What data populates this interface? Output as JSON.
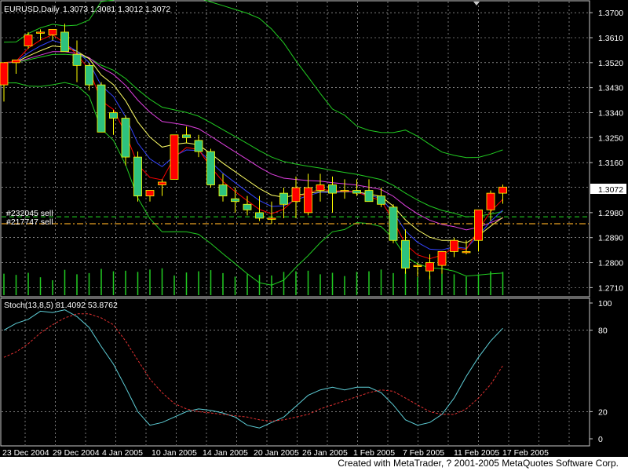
{
  "header": {
    "symbol": "EURUSD,Daily",
    "ohlc": "1.3073 1.3081 1.3012 1.3072"
  },
  "orders": [
    "#232045 sell",
    "#217747 sell"
  ],
  "stoch": {
    "label": "Stoch(13,8,5) 81.4092 53.8762"
  },
  "credit": "Created with MetaTrader, ? 2001-2005 MetaQuotes Software Corp.",
  "current_price": "1.3072",
  "price_axis": [
    "1.3700",
    "1.3610",
    "1.3520",
    "1.3430",
    "1.3340",
    "1.3250",
    "1.3160",
    "1.3072",
    "1.2980",
    "1.2890",
    "1.2800",
    "1.2710"
  ],
  "stoch_axis": [
    "100",
    "80",
    "20",
    "0"
  ],
  "date_axis": [
    "23 Dec 2004",
    "29 Dec 2004",
    "4 Jan 2005",
    "10 Jan 2005",
    "14 Jan 2005",
    "20 Jan 2005",
    "26 Jan 2005",
    "1 Feb 2005",
    "7 Feb 2005",
    "11 Feb 2005",
    "17 Feb 2005"
  ],
  "colors": {
    "background": "#000000",
    "grid": "#c8c8c8",
    "bull": "#ff0000",
    "bear": "#2ec27e",
    "wick": "#ffff00",
    "ma_red": "#ff0000",
    "ma_blue": "#3344ff",
    "ma_yellow": "#ffff66",
    "ma_magenta": "#e040e0",
    "bands": "#22cc22",
    "volume": "#22cc22",
    "stoch_main": "#5ecfd8",
    "stoch_signal": "#e03030",
    "order1_line": "#22cc22",
    "order2_line": "#e8a020"
  },
  "chart_data": [
    {
      "type": "candlestick",
      "title": "EURUSD,Daily",
      "ylim": [
        1.268,
        1.374
      ],
      "x": [
        "22 Dec 2004",
        "23 Dec 2004",
        "24 Dec 2004",
        "27 Dec 2004",
        "28 Dec 2004",
        "29 Dec 2004",
        "30 Dec 2004",
        "31 Dec 2004",
        "3 Jan 2005",
        "4 Jan 2005",
        "5 Jan 2005",
        "6 Jan 2005",
        "7 Jan 2005",
        "10 Jan 2005",
        "11 Jan 2005",
        "12 Jan 2005",
        "13 Jan 2005",
        "14 Jan 2005",
        "17 Jan 2005",
        "18 Jan 2005",
        "19 Jan 2005",
        "20 Jan 2005",
        "21 Jan 2005",
        "24 Jan 2005",
        "25 Jan 2005",
        "26 Jan 2005",
        "27 Jan 2005",
        "28 Jan 2005",
        "31 Jan 2005",
        "1 Feb 2005",
        "2 Feb 2005",
        "3 Feb 2005",
        "4 Feb 2005",
        "7 Feb 2005",
        "8 Feb 2005",
        "9 Feb 2005",
        "10 Feb 2005",
        "11 Feb 2005",
        "14 Feb 2005",
        "15 Feb 2005",
        "16 Feb 2005",
        "17 Feb 2005"
      ],
      "open": [
        1.344,
        1.352,
        1.358,
        1.363,
        1.362,
        1.363,
        1.355,
        1.351,
        1.344,
        1.334,
        1.332,
        1.318,
        1.304,
        1.308,
        1.31,
        1.326,
        1.324,
        1.32,
        1.308,
        1.303,
        1.301,
        1.298,
        1.296,
        1.305,
        1.302,
        1.298,
        1.306,
        1.308,
        1.306,
        1.306,
        1.306,
        1.304,
        1.3,
        1.288,
        1.279,
        1.277,
        1.279,
        1.284,
        1.284,
        1.288,
        1.299,
        1.305
      ],
      "high": [
        1.345,
        1.353,
        1.363,
        1.364,
        1.364,
        1.366,
        1.36,
        1.352,
        1.345,
        1.335,
        1.333,
        1.32,
        1.306,
        1.31,
        1.321,
        1.329,
        1.326,
        1.321,
        1.312,
        1.307,
        1.304,
        1.304,
        1.302,
        1.307,
        1.311,
        1.312,
        1.312,
        1.311,
        1.31,
        1.31,
        1.31,
        1.307,
        1.301,
        1.292,
        1.28,
        1.283,
        1.282,
        1.289,
        1.288,
        1.299,
        1.306,
        1.3081
      ],
      "low": [
        1.338,
        1.348,
        1.357,
        1.36,
        1.36,
        1.357,
        1.345,
        1.342,
        1.329,
        1.326,
        1.315,
        1.302,
        1.302,
        1.304,
        1.31,
        1.323,
        1.318,
        1.307,
        1.302,
        1.298,
        1.297,
        1.295,
        1.294,
        1.296,
        1.296,
        1.297,
        1.302,
        1.298,
        1.303,
        1.304,
        1.303,
        1.3,
        1.287,
        1.276,
        1.275,
        1.274,
        1.276,
        1.282,
        1.283,
        1.284,
        1.295,
        1.3012
      ],
      "close": [
        1.352,
        1.353,
        1.362,
        1.363,
        1.364,
        1.356,
        1.351,
        1.344,
        1.327,
        1.332,
        1.318,
        1.304,
        1.306,
        1.309,
        1.326,
        1.325,
        1.32,
        1.308,
        1.304,
        1.302,
        1.299,
        1.296,
        1.296,
        1.301,
        1.307,
        1.307,
        1.308,
        1.305,
        1.306,
        1.305,
        1.302,
        1.301,
        1.288,
        1.278,
        1.279,
        1.28,
        1.284,
        1.288,
        1.284,
        1.299,
        1.305,
        1.3072
      ],
      "volume": [
        0.72,
        0.68,
        0.75,
        0.6,
        0.5,
        0.85,
        0.7,
        0.74,
        0.88,
        0.8,
        0.82,
        0.78,
        0.86,
        0.9,
        0.66,
        0.76,
        0.8,
        0.84,
        0.74,
        0.62,
        0.7,
        0.68,
        0.66,
        0.78,
        0.8,
        0.82,
        0.7,
        0.75,
        0.64,
        0.78,
        0.8,
        0.86,
        0.74,
        0.8,
        0.6,
        0.66,
        0.72,
        0.7,
        0.62,
        0.7,
        0.8,
        0.78
      ]
    },
    {
      "type": "line",
      "title": "Stoch(13,8,5) 81.4092 53.8762",
      "ylim": [
        0,
        100
      ],
      "x_positions_match_candles": true,
      "series": [
        {
          "values": [
            80,
            85,
            88,
            94,
            93,
            95,
            90,
            82,
            68,
            55,
            38,
            20,
            10,
            12,
            16,
            20,
            22,
            21,
            19,
            16,
            10,
            8,
            12,
            16,
            24,
            32,
            36,
            38,
            36,
            38,
            38,
            34,
            25,
            14,
            10,
            12,
            18,
            30,
            46,
            60,
            72,
            81.4092
          ]
        },
        {
          "values": [
            60,
            64,
            70,
            78,
            84,
            89,
            92,
            92,
            89,
            84,
            72,
            58,
            44,
            34,
            26,
            22,
            20,
            19,
            18,
            17,
            16,
            14,
            13,
            14,
            16,
            18,
            22,
            25,
            28,
            31,
            34,
            36,
            35,
            30,
            25,
            20,
            18,
            18,
            22,
            30,
            40,
            53.8762
          ]
        }
      ]
    }
  ]
}
